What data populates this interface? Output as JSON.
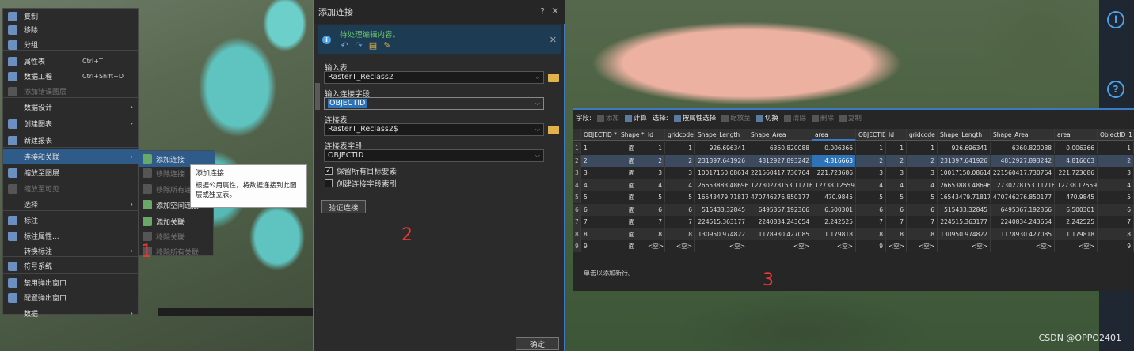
{
  "context_menu": {
    "items": [
      {
        "label": "复制",
        "shortcut": "",
        "disabled": false,
        "submenu": false,
        "icon": "copy-icon"
      },
      {
        "label": "移除",
        "shortcut": "",
        "disabled": false,
        "submenu": false,
        "icon": "remove-icon"
      },
      {
        "label": "分组",
        "shortcut": "",
        "disabled": false,
        "submenu": false,
        "icon": "group-icon"
      },
      {
        "label": "属性表",
        "shortcut": "Ctrl+T",
        "disabled": false,
        "submenu": false,
        "icon": "attribute-table-icon"
      },
      {
        "label": "数据工程",
        "shortcut": "Ctrl+Shift+D",
        "disabled": false,
        "submenu": false,
        "icon": "data-engineering-icon"
      },
      {
        "label": "添加错误图层",
        "shortcut": "",
        "disabled": true,
        "submenu": false,
        "icon": "error-layer-icon"
      },
      {
        "label": "数据设计",
        "shortcut": "",
        "disabled": false,
        "submenu": true,
        "icon": ""
      },
      {
        "label": "创建图表",
        "shortcut": "",
        "disabled": false,
        "submenu": true,
        "icon": "chart-icon"
      },
      {
        "label": "新建报表",
        "shortcut": "",
        "disabled": false,
        "submenu": false,
        "icon": "report-icon"
      },
      {
        "label": "连接和关联",
        "shortcut": "",
        "disabled": false,
        "submenu": true,
        "icon": ""
      },
      {
        "label": "缩放至图层",
        "shortcut": "",
        "disabled": false,
        "submenu": false,
        "icon": "zoom-layer-icon"
      },
      {
        "label": "缩放至可见",
        "shortcut": "",
        "disabled": true,
        "submenu": false,
        "icon": "zoom-visible-icon"
      },
      {
        "label": "选择",
        "shortcut": "",
        "disabled": false,
        "submenu": true,
        "icon": ""
      },
      {
        "label": "标注",
        "shortcut": "",
        "disabled": false,
        "submenu": false,
        "icon": "label-icon"
      },
      {
        "label": "标注属性...",
        "shortcut": "",
        "disabled": false,
        "submenu": false,
        "icon": "label-props-icon"
      },
      {
        "label": "转换标注",
        "shortcut": "",
        "disabled": false,
        "submenu": true,
        "icon": ""
      },
      {
        "label": "符号系统",
        "shortcut": "",
        "disabled": false,
        "submenu": false,
        "icon": "symbology-icon"
      },
      {
        "label": "禁用弹出窗口",
        "shortcut": "",
        "disabled": false,
        "submenu": false,
        "icon": "popup-disable-icon"
      },
      {
        "label": "配置弹出窗口",
        "shortcut": "",
        "disabled": false,
        "submenu": false,
        "icon": "popup-config-icon"
      },
      {
        "label": "数据",
        "shortcut": "",
        "disabled": false,
        "submenu": true,
        "icon": ""
      }
    ]
  },
  "submenu": {
    "items": [
      {
        "label": "添加连接",
        "disabled": false,
        "icon": "add-join-icon"
      },
      {
        "label": "移除连接",
        "disabled": true,
        "icon": "remove-join-icon"
      },
      {
        "label": "移除所有连接",
        "disabled": true,
        "icon": "remove-all-joins-icon"
      },
      {
        "label": "添加空间连接",
        "disabled": false,
        "icon": "spatial-join-icon"
      },
      {
        "label": "添加关联",
        "disabled": false,
        "icon": "add-relate-icon"
      },
      {
        "label": "移除关联",
        "disabled": true,
        "icon": "remove-relate-icon"
      },
      {
        "label": "移除所有关联",
        "disabled": true,
        "icon": "remove-all-relates-icon"
      }
    ]
  },
  "tooltip": {
    "title": "添加连接",
    "line1": "根据公用属性，将数据连接到此图",
    "line2": "层或独立表。"
  },
  "annotations": {
    "one": "1",
    "two": "2",
    "three": "3"
  },
  "dialog": {
    "title": "添加连接",
    "help": "?",
    "close": "✕",
    "info_message": "待处理编辑内容。",
    "input_table_label": "输入表",
    "input_table_value": "RasterT_Reclass2",
    "input_join_field_label": "输入连接字段",
    "input_join_field_value": "OBJECTID",
    "join_table_label": "连接表",
    "join_table_value": "RasterT_Reclass2$",
    "join_table_field_label": "连接表字段",
    "join_table_field_value": "OBJECTID",
    "keep_all_label": "保留所有目标要素",
    "keep_all_checked": true,
    "index_label": "创建连接字段索引",
    "index_checked": false,
    "validate_button": "验证连接",
    "ok_button": "确定"
  },
  "table": {
    "toolbar": [
      {
        "label": "字段:",
        "icon": false,
        "disabled": false
      },
      {
        "label": "添加",
        "icon": true,
        "disabled": true
      },
      {
        "label": "计算",
        "icon": true,
        "disabled": false
      },
      {
        "label": "选择:",
        "icon": false,
        "disabled": false
      },
      {
        "label": "按属性选择",
        "icon": true,
        "disabled": false
      },
      {
        "label": "缩放至",
        "icon": true,
        "disabled": true
      },
      {
        "label": "切换",
        "icon": true,
        "disabled": false
      },
      {
        "label": "清除",
        "icon": true,
        "disabled": true
      },
      {
        "label": "删除",
        "icon": true,
        "disabled": true
      },
      {
        "label": "复制",
        "icon": true,
        "disabled": true
      }
    ],
    "columns": [
      "OBJECTID *",
      "Shape *",
      "Id",
      "gridcode",
      "Shape_Length",
      "Shape_Area",
      "area",
      "OBJECTID",
      "Id",
      "gridcode",
      "Shape_Length",
      "Shape_Area",
      "area",
      "ObjectID_1 *"
    ],
    "rows": [
      [
        "1",
        "面",
        "1",
        "1",
        "926.696341",
        "6360.820088",
        "0.006366",
        "1",
        "1",
        "1",
        "926.696341",
        "6360.820088",
        "0.006366",
        "1"
      ],
      [
        "2",
        "面",
        "2",
        "2",
        "231397.641926",
        "4812927.893242",
        "4.816663",
        "2",
        "2",
        "2",
        "231397.641926",
        "4812927.893242",
        "4.816663",
        "2"
      ],
      [
        "3",
        "面",
        "3",
        "3",
        "10017150.086147",
        "221560417.730764",
        "221.723686",
        "3",
        "3",
        "3",
        "10017150.086147",
        "221560417.730764",
        "221.723686",
        "3"
      ],
      [
        "4",
        "面",
        "4",
        "4",
        "26653883.486967",
        "12730278153.117165",
        "12738.125596",
        "4",
        "4",
        "4",
        "26653883.486967",
        "12730278153.117165",
        "12738.125596",
        "4"
      ],
      [
        "5",
        "面",
        "5",
        "5",
        "16543479.718177",
        "470746276.850177",
        "470.9845",
        "5",
        "5",
        "5",
        "16543479.718177",
        "470746276.850177",
        "470.9845",
        "5"
      ],
      [
        "6",
        "面",
        "6",
        "6",
        "515433.32845",
        "6495367.192366",
        "6.500301",
        "6",
        "6",
        "6",
        "515433.32845",
        "6495367.192366",
        "6.500301",
        "6"
      ],
      [
        "7",
        "面",
        "7",
        "7",
        "224515.363177",
        "2240834.243654",
        "2.242525",
        "7",
        "7",
        "7",
        "224515.363177",
        "2240834.243654",
        "2.242525",
        "7"
      ],
      [
        "8",
        "面",
        "8",
        "8",
        "130950.974822",
        "1178930.427085",
        "1.179818",
        "8",
        "8",
        "8",
        "130950.974822",
        "1178930.427085",
        "1.179818",
        "8"
      ],
      [
        "9",
        "面",
        "<空>",
        "<空>",
        "<空>",
        "<空>",
        "<空>",
        "9",
        "<空>",
        "<空>",
        "<空>",
        "<空>",
        "<空>",
        "9"
      ]
    ],
    "status": "单击以添加新行。"
  },
  "watermark": "CSDN @OPPO2401"
}
